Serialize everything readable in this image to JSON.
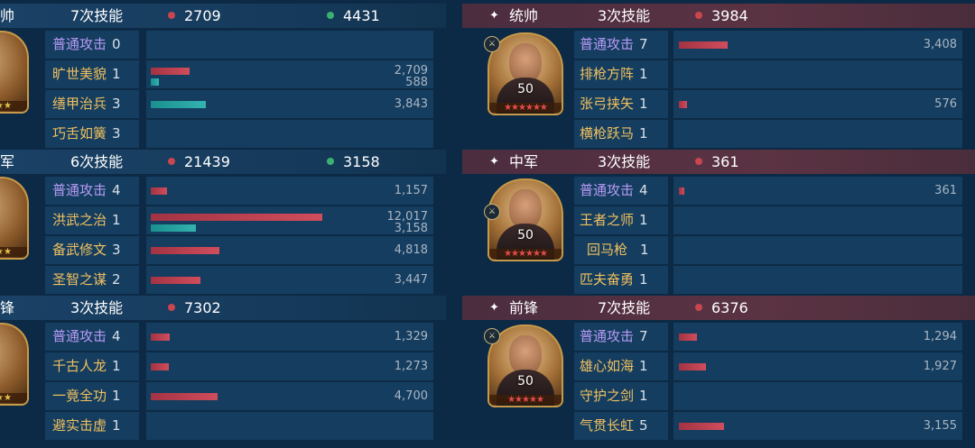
{
  "left": [
    {
      "role": "帅",
      "skill_count": "7次技能",
      "damage": "2709",
      "heal": "4431",
      "rows": [
        {
          "name": "普通攻击",
          "count": "0",
          "type": "purple",
          "bars": [],
          "values": []
        },
        {
          "name": "旷世美貌",
          "count": "1",
          "type": "gold",
          "bars": [
            {
              "color": "red",
              "value": 2709
            },
            {
              "color": "teal",
              "value": 588
            }
          ],
          "values": [
            "2,709",
            "588"
          ]
        },
        {
          "name": "缮甲治兵",
          "count": "3",
          "type": "gold",
          "bars": [
            {
              "color": "teal",
              "value": 3843
            }
          ],
          "values": [
            "3,843"
          ]
        },
        {
          "name": "巧舌如簧",
          "count": "3",
          "type": "gold",
          "bars": [],
          "values": []
        }
      ]
    },
    {
      "role": "军",
      "skill_count": "6次技能",
      "damage": "21439",
      "heal": "3158",
      "rows": [
        {
          "name": "普通攻击",
          "count": "4",
          "type": "purple",
          "bars": [
            {
              "color": "red",
              "value": 1157
            }
          ],
          "values": [
            "1,157"
          ]
        },
        {
          "name": "洪武之治",
          "count": "1",
          "type": "gold",
          "bars": [
            {
              "color": "red",
              "value": 12017
            },
            {
              "color": "teal",
              "value": 3158
            }
          ],
          "values": [
            "12,017",
            "3,158"
          ]
        },
        {
          "name": "备武修文",
          "count": "3",
          "type": "gold",
          "bars": [
            {
              "color": "red",
              "value": 4818
            }
          ],
          "values": [
            "4,818"
          ]
        },
        {
          "name": "圣智之谋",
          "count": "2",
          "type": "gold",
          "bars": [
            {
              "color": "red",
              "value": 3447
            }
          ],
          "values": [
            "3,447"
          ]
        }
      ]
    },
    {
      "role": "锋",
      "skill_count": "3次技能",
      "damage": "7302",
      "heal": "",
      "rows": [
        {
          "name": "普通攻击",
          "count": "4",
          "type": "purple",
          "bars": [
            {
              "color": "red",
              "value": 1329
            }
          ],
          "values": [
            "1,329"
          ]
        },
        {
          "name": "千古人龙",
          "count": "1",
          "type": "gold",
          "bars": [
            {
              "color": "red",
              "value": 1273
            }
          ],
          "values": [
            "1,273"
          ]
        },
        {
          "name": "一竟全功",
          "count": "1",
          "type": "gold",
          "bars": [
            {
              "color": "red",
              "value": 4700
            }
          ],
          "values": [
            "4,700"
          ]
        },
        {
          "name": "避实击虚",
          "count": "1",
          "type": "gold",
          "bars": [],
          "values": []
        }
      ]
    }
  ],
  "right": [
    {
      "role": "统帅",
      "skill_count": "3次技能",
      "damage": "3984",
      "level": "50",
      "stars": "★★★★★★",
      "rows": [
        {
          "name": "普通攻击",
          "count": "7",
          "type": "purple",
          "bars": [
            {
              "color": "red",
              "value": 3408
            }
          ],
          "values": [
            "3,408"
          ]
        },
        {
          "name": "排枪方阵",
          "count": "1",
          "type": "gold",
          "bars": [],
          "values": []
        },
        {
          "name": "张弓挟矢",
          "count": "1",
          "type": "gold",
          "bars": [
            {
              "color": "red",
              "value": 576
            }
          ],
          "values": [
            "576"
          ]
        },
        {
          "name": "横枪跃马",
          "count": "1",
          "type": "gold",
          "bars": [],
          "values": []
        }
      ]
    },
    {
      "role": "中军",
      "skill_count": "3次技能",
      "damage": "361",
      "level": "50",
      "stars": "★★★★★★",
      "rows": [
        {
          "name": "普通攻击",
          "count": "4",
          "type": "purple",
          "bars": [
            {
              "color": "red",
              "value": 361
            }
          ],
          "values": [
            "361"
          ]
        },
        {
          "name": "王者之师",
          "count": "1",
          "type": "gold",
          "bars": [],
          "values": []
        },
        {
          "name": "回马枪",
          "count": "1",
          "type": "gold",
          "bars": [],
          "values": []
        },
        {
          "name": "匹夫奋勇",
          "count": "1",
          "type": "gold",
          "bars": [],
          "values": []
        }
      ]
    },
    {
      "role": "前锋",
      "skill_count": "7次技能",
      "damage": "6376",
      "level": "50",
      "stars": "★★★★★",
      "rows": [
        {
          "name": "普通攻击",
          "count": "7",
          "type": "purple",
          "bars": [
            {
              "color": "red",
              "value": 1294
            }
          ],
          "values": [
            "1,294"
          ]
        },
        {
          "name": "雄心如海",
          "count": "1",
          "type": "gold",
          "bars": [
            {
              "color": "red",
              "value": 1927
            }
          ],
          "values": [
            "1,927"
          ]
        },
        {
          "name": "守护之剑",
          "count": "1",
          "type": "gold",
          "bars": [],
          "values": []
        },
        {
          "name": "气贯长虹",
          "count": "5",
          "type": "gold",
          "bars": [
            {
              "color": "red",
              "value": 3155
            }
          ],
          "values": [
            "3,155"
          ]
        }
      ]
    }
  ],
  "star_glyph": "✦",
  "colors": {
    "damage_dot": "#c94650",
    "heal_dot": "#3bb070",
    "skill_purple": "#b79bf5",
    "skill_gold": "#f0c060"
  }
}
